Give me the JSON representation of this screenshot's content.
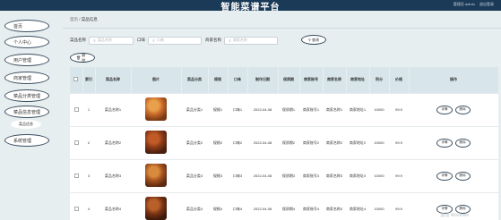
{
  "header": {
    "title": "智能菜谱平台",
    "user_text": "管理员 admin",
    "logout": "退出登录"
  },
  "sidebar": {
    "items": [
      {
        "label": "首页"
      },
      {
        "label": "个人中心"
      },
      {
        "label": "用户管理"
      },
      {
        "label": "商家管理"
      },
      {
        "label": "菜品分类管理"
      },
      {
        "label": "菜品信息管理"
      },
      {
        "label": "系统管理"
      }
    ],
    "sub_item": "菜品信息"
  },
  "breadcrumb": {
    "home": "首页",
    "separator": "/",
    "current": "菜品信息"
  },
  "search": {
    "name_label": "菜品名称",
    "name_placeholder": "菜品名称",
    "taste_label": "口味",
    "taste_placeholder": "口味",
    "merchant_label": "商家名称",
    "merchant_placeholder": "商家名称",
    "search_button": "查询",
    "delete_button": "删除"
  },
  "table": {
    "columns": [
      "",
      "索引",
      "菜品名称",
      "图片",
      "菜品分类",
      "规格",
      "口味",
      "制作日期",
      "保质期",
      "商家账号",
      "商家名称",
      "商家地址",
      "积分",
      "价格",
      "操作"
    ],
    "rows": [
      {
        "index": "1",
        "name": "菜品名称1",
        "category": "菜品分类1",
        "spec": "规格1",
        "taste": "口味1",
        "date": "2022-04-08",
        "shelf": "保质期1",
        "account": "商家账号1",
        "merchant": "商家名称1",
        "address": "商家地址1",
        "points": "10000",
        "price": "99.9"
      },
      {
        "index": "2",
        "name": "菜品名称2",
        "category": "菜品分类2",
        "spec": "规格2",
        "taste": "口味2",
        "date": "2022-04-08",
        "shelf": "保质期2",
        "account": "商家账号2",
        "merchant": "商家名称2",
        "address": "商家地址2",
        "points": "10000",
        "price": "99.9"
      },
      {
        "index": "3",
        "name": "菜品名称3",
        "category": "菜品分类3",
        "spec": "规格3",
        "taste": "口味3",
        "date": "2022-04-08",
        "shelf": "保质期3",
        "account": "商家账号3",
        "merchant": "商家名称3",
        "address": "商家地址3",
        "points": "10000",
        "price": "99.9"
      },
      {
        "index": "4",
        "name": "菜品名称4",
        "category": "菜品分类4",
        "spec": "规格4",
        "taste": "口味4",
        "date": "2022-04-08",
        "shelf": "保质期4",
        "account": "商家账号4",
        "merchant": "商家名称4",
        "address": "商家地址4",
        "points": "10000",
        "price": "99.9"
      }
    ],
    "detail_button": "详情",
    "delete_button": "删除"
  },
  "watermark": "激活 Windows",
  "colors": {
    "topbar": "#1a3a57",
    "header_row": "#d8e6eb",
    "background": "#e7eef0"
  }
}
